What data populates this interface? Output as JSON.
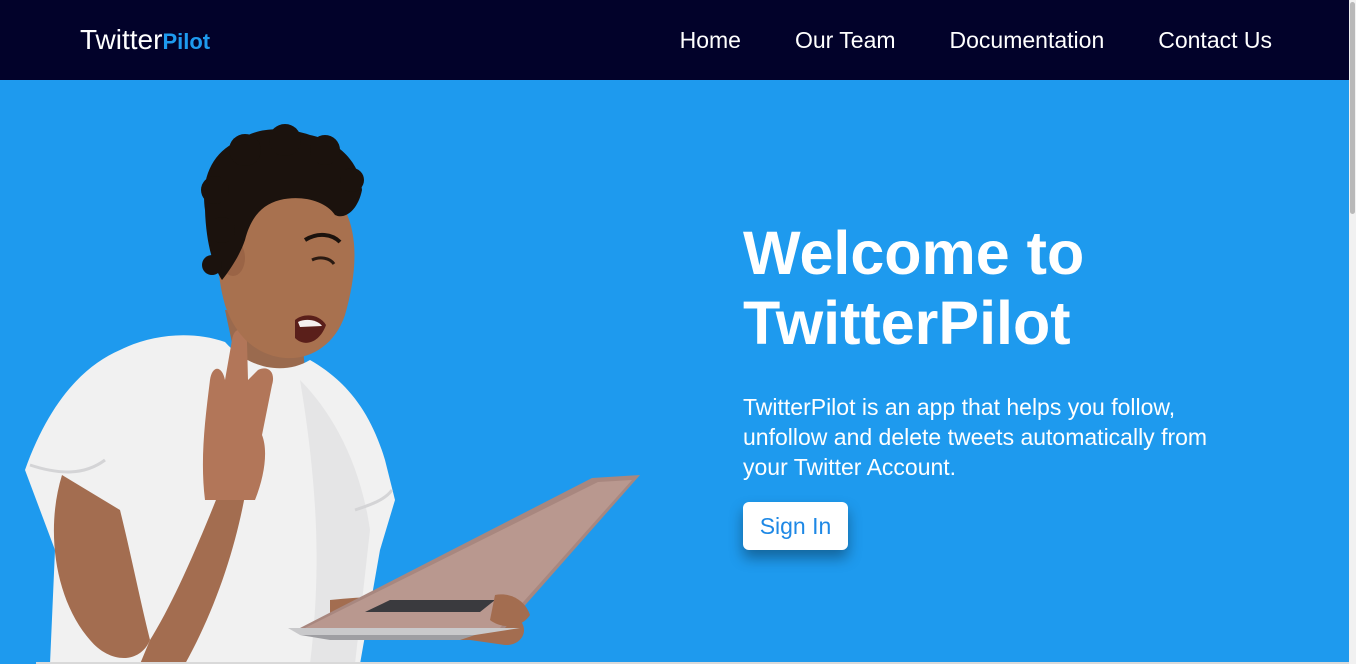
{
  "navbar": {
    "brand_main": "Twitter",
    "brand_accent": "Pilot",
    "links": [
      "Home",
      "Our Team",
      "Documentation",
      "Contact Us"
    ]
  },
  "hero": {
    "title_line1": "Welcome to",
    "title_line2": "TwitterPilot",
    "description": "TwitterPilot is an app that helps you follow, unfollow and delete tweets automatically from your Twitter Account.",
    "cta_label": "Sign In"
  },
  "colors": {
    "navbar_bg": "#02022a",
    "hero_bg": "#1e9aee",
    "accent": "#1e9aee",
    "button_text": "#1e88e5"
  }
}
